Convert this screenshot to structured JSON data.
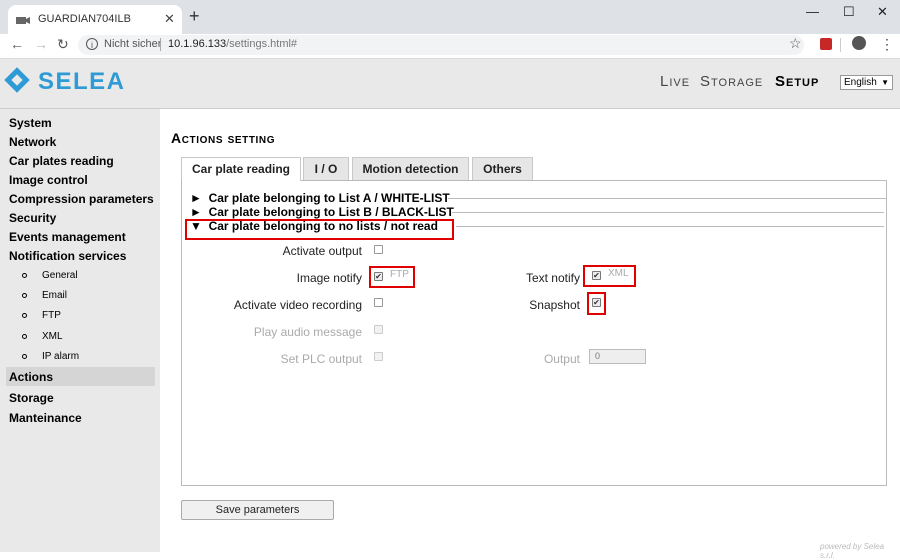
{
  "browser": {
    "tab_title": "GUARDIAN704ILB",
    "new_tab": "+",
    "url_security": "Nicht sicher",
    "url_host": "10.1.96.133",
    "url_path": "/settings.html#"
  },
  "app": {
    "logo": "SELEA",
    "nav": {
      "live": "Live",
      "storage": "Storage",
      "setup": "Setup"
    },
    "language": "English"
  },
  "sidebar": {
    "items": [
      "System",
      "Network",
      "Car plates reading",
      "Image control",
      "Compression parameters",
      "Security",
      "Events management",
      "Notification services"
    ],
    "sub_items": [
      "General",
      "Email",
      "FTP",
      "XML",
      "IP alarm"
    ],
    "bottom_items": [
      "Actions",
      "Storage",
      "Manteinance"
    ],
    "active": "Actions"
  },
  "main": {
    "title": "Actions setting",
    "tabs": [
      "Car plate reading",
      "I / O",
      "Motion detection",
      "Others"
    ],
    "active_tab": "Car plate reading",
    "accordion": [
      {
        "arrow": "►",
        "label": "Car plate belonging to List A / WHITE-LIST"
      },
      {
        "arrow": "►",
        "label": "Car plate belonging to List B / BLACK-LIST"
      },
      {
        "arrow": "▼",
        "label": "Car plate belonging to no lists / not read"
      }
    ],
    "form": {
      "activate_output": "Activate output",
      "image_notify": "Image notify",
      "image_notify_value": "FTP",
      "text_notify": "Text notify",
      "text_notify_value": "XML",
      "activate_video": "Activate video recording",
      "snapshot": "Snapshot",
      "play_audio": "Play audio message",
      "set_plc": "Set PLC output",
      "output": "Output",
      "output_value": "0"
    },
    "save_button": "Save parameters"
  },
  "footer": "powered by Selea s.r.l.",
  "colors": {
    "brand": "#2e9bd6",
    "highlight": "#e00000"
  }
}
